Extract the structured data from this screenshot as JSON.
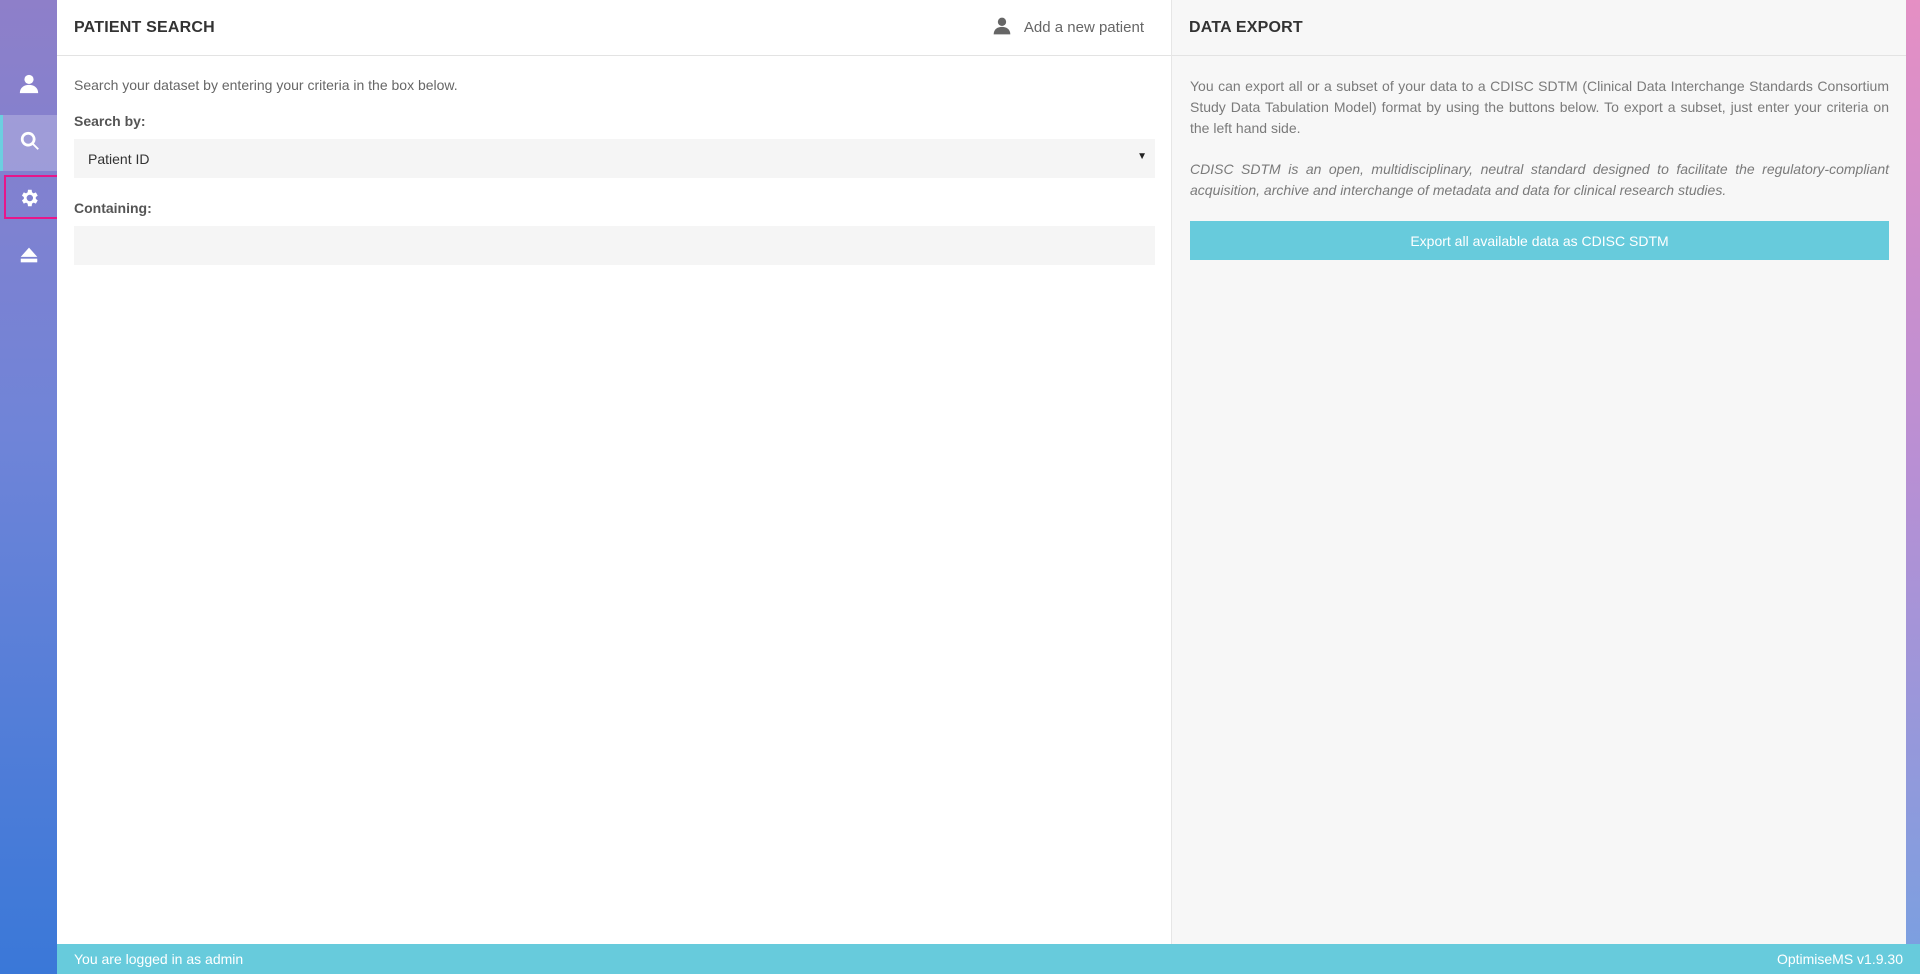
{
  "sidebar": {
    "items": [
      {
        "icon": "user-icon",
        "label": "Patient"
      },
      {
        "icon": "search-icon",
        "label": "Search",
        "active": true
      },
      {
        "icon": "gear-icon",
        "label": "Settings"
      },
      {
        "icon": "eject-icon",
        "label": "Logout"
      }
    ]
  },
  "patient_search": {
    "title": "PATIENT SEARCH",
    "add_patient_label": "Add a new patient",
    "description": "Search your dataset by entering your criteria in the box below.",
    "search_by_label": "Search by:",
    "search_by_value": "Patient ID",
    "containing_label": "Containing:",
    "containing_value": ""
  },
  "data_export": {
    "title": "DATA EXPORT",
    "paragraph1": "You can export all or a subset of your data to a CDISC SDTM (Clinical Data Interchange Standards Consortium Study Data Tabulation Model) format by using the buttons below. To export a subset, just enter your criteria on the left hand side.",
    "paragraph2": "CDISC SDTM is an open, multidisciplinary, neutral standard designed to facilitate the regulatory-compliant acquisition, archive and interchange of metadata and data for clinical research studies.",
    "export_button_label": "Export all available data as CDISC SDTM"
  },
  "footer": {
    "login_status": "You are logged in as admin",
    "version": "OptimiseMS v1.9.30"
  },
  "colors": {
    "accent": "#67cbdc",
    "highlight_border": "#e8168a"
  }
}
